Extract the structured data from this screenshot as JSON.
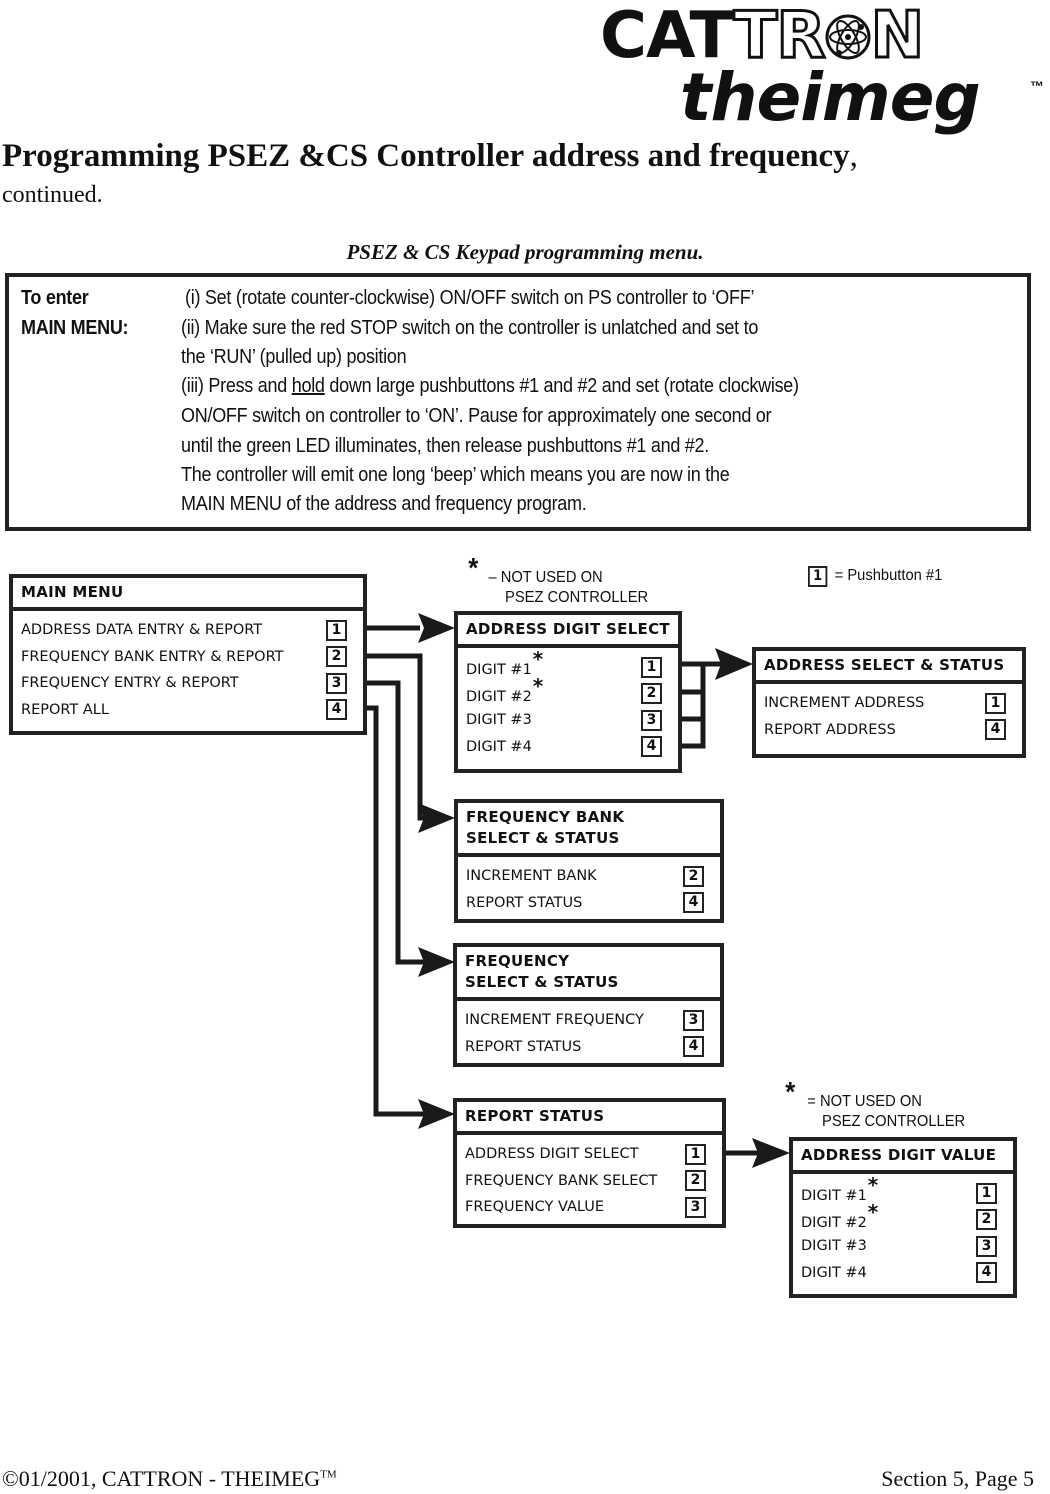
{
  "logo": {
    "line1_solid": "CAT",
    "line1_outline_a": "TR",
    "atom_icon": "atom-icon",
    "line1_outline_b": "N",
    "line2": "theimeg",
    "tm": "™"
  },
  "header": {
    "title": "Programming PSEZ &CS Controller address and frequency",
    "title_comma": ",",
    "subtitle": "continued.",
    "caption": "PSEZ & CS Keypad programming menu."
  },
  "instructions": {
    "label_line1": "To enter",
    "label_line2": "MAIN MENU:",
    "step1": "(i)  Set (rotate counter-clockwise) ON/OFF switch on PS controller to ‘OFF’",
    "step2_line1": "(ii)  Make sure the red STOP switch on the controller is unlatched and set to",
    "step2_line2": " the ‘RUN’ (pulled up) position",
    "step3_pre": "(iii) Press and ",
    "step3_underlined": "hold",
    "step3_post": " down large pushbuttons #1 and #2 and set (rotate clockwise)",
    "step3_line2": "ON/OFF switch on controller to ‘ON’.  Pause for approximately one second or",
    "step3_line3": "until the green LED illuminates, then release pushbuttons #1 and #2.",
    "step3_line4": "The controller will emit one long ‘beep’ which means you are now in the",
    "step3_line5": "MAIN MENU of the address and frequency program."
  },
  "legend": {
    "star_symbol": "*",
    "star_note_top_line1": "– NOT USED ON",
    "star_note_top_line2": "PSEZ CONTROLLER",
    "star_note_bottom_line1": "= NOT USED ON",
    "star_note_bottom_line2": "PSEZ CONTROLLER",
    "key_example": "1",
    "key_example_text": "= Pushbutton #1"
  },
  "menus": {
    "main": {
      "title": "MAIN MENU",
      "items": [
        {
          "label": "ADDRESS DATA ENTRY & REPORT",
          "key": "1"
        },
        {
          "label": "FREQUENCY BANK ENTRY & REPORT",
          "key": "2"
        },
        {
          "label": "FREQUENCY ENTRY & REPORT",
          "key": "3"
        },
        {
          "label": "REPORT ALL",
          "key": "4"
        }
      ]
    },
    "address_digit_select": {
      "title": "ADDRESS DIGIT SELECT",
      "items": [
        {
          "label": "DIGIT #1",
          "key": "1",
          "star": "*"
        },
        {
          "label": "DIGIT #2",
          "key": "2",
          "star": "*"
        },
        {
          "label": "DIGIT #3",
          "key": "3"
        },
        {
          "label": "DIGIT #4",
          "key": "4"
        }
      ]
    },
    "address_select_status": {
      "title": "ADDRESS SELECT & STATUS",
      "items": [
        {
          "label": "INCREMENT ADDRESS",
          "key": "1"
        },
        {
          "label": "REPORT ADDRESS",
          "key": "4"
        }
      ]
    },
    "frequency_bank": {
      "title_line1": "FREQUENCY BANK",
      "title_line2": "SELECT & STATUS",
      "items": [
        {
          "label": "INCREMENT BANK",
          "key": "2"
        },
        {
          "label": "REPORT STATUS",
          "key": "4"
        }
      ]
    },
    "frequency": {
      "title_line1": "FREQUENCY",
      "title_line2": "SELECT & STATUS",
      "items": [
        {
          "label": "INCREMENT FREQUENCY",
          "key": "3"
        },
        {
          "label": "REPORT STATUS",
          "key": "4"
        }
      ]
    },
    "report_status": {
      "title": "REPORT STATUS",
      "items": [
        {
          "label": "ADDRESS DIGIT SELECT",
          "key": "1"
        },
        {
          "label": "FREQUENCY BANK SELECT",
          "key": "2"
        },
        {
          "label": "FREQUENCY VALUE",
          "key": "3"
        }
      ]
    },
    "address_digit_value": {
      "title": "ADDRESS DIGIT VALUE",
      "items": [
        {
          "label": "DIGIT #1",
          "key": "1",
          "star": "*"
        },
        {
          "label": "DIGIT #2",
          "key": "2",
          "star": "*"
        },
        {
          "label": "DIGIT #3",
          "key": "3"
        },
        {
          "label": "DIGIT #4",
          "key": "4"
        }
      ]
    }
  },
  "footer": {
    "copyright": "©01/2001, CATTRON - THEIMEG",
    "tm": "TM",
    "page": "Section 5, Page 5"
  }
}
